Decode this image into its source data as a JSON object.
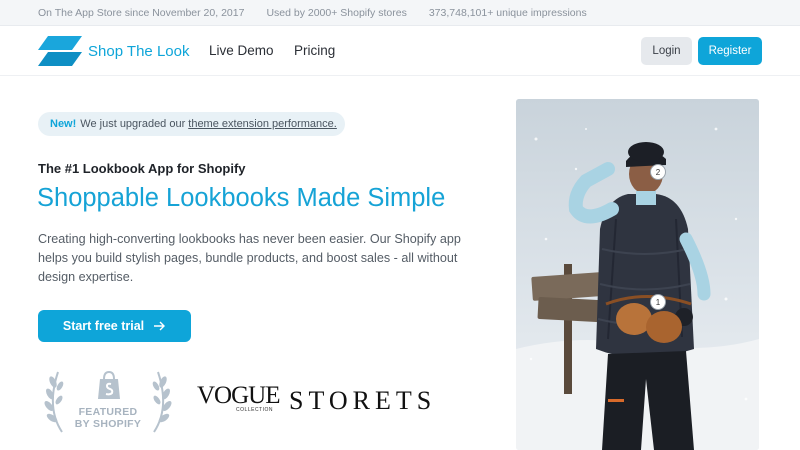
{
  "topbar": {
    "since": "On The App Store since November 20, 2017",
    "used_by": "Used by 2000+ Shopify stores",
    "impressions": "373,748,101+ unique impressions"
  },
  "nav": {
    "brand": "Shop The Look",
    "links": [
      "Live Demo",
      "Pricing"
    ],
    "login": "Login",
    "register": "Register"
  },
  "announcement": {
    "badge": "New!",
    "text": "We just upgraded our",
    "link": "theme extension performance."
  },
  "hero": {
    "subtitle": "The #1 Lookbook App for Shopify",
    "headline": "Shoppable Lookbooks Made Simple",
    "description": "Creating high-converting lookbooks has never been easier. Our Shopify app helps you build stylish pages, bundle products, and boost sales - all without design expertise.",
    "cta": "Start free trial",
    "cta_icon": "arrow-right-icon",
    "hotspots": [
      "2",
      "1"
    ]
  },
  "badges": {
    "featured_line1": "FEATURED",
    "featured_line2": "BY SHOPIFY",
    "vogue": "VOGUE",
    "vogue_sub": "COLLECTION",
    "storets": "STORETS"
  },
  "colors": {
    "accent": "#0ea5d9",
    "headline": "#16a3d6",
    "topbar_bg": "#f4f6f8",
    "announce_bg": "#e8f1f6"
  }
}
